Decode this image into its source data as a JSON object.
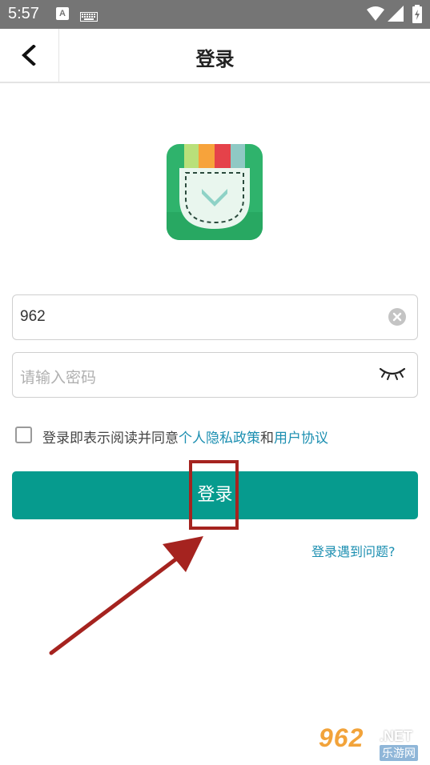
{
  "status_bar": {
    "time": "5:57",
    "notification_letter": "A"
  },
  "header": {
    "title": "登录"
  },
  "form": {
    "username_value": "962",
    "password_placeholder": "请输入密码"
  },
  "agreement": {
    "prefix": "登录即表示阅读并同意",
    "privacy_link": "个人隐私政策",
    "and": "和",
    "terms_link": "用户协议"
  },
  "login_button": "登录",
  "help_link": "登录遇到问题?",
  "watermark": {
    "number": "962",
    "suffix": ".NET",
    "cn": "乐游网"
  },
  "colors": {
    "primary": "#069b8e",
    "link": "#1c8fb1",
    "annotation": "#a5231f",
    "status_bar": "#757575"
  },
  "icons": [
    "wifi-icon",
    "signal-icon",
    "battery-icon",
    "back-arrow-icon",
    "clear-icon",
    "eye-closed-icon",
    "app-logo-icon"
  ]
}
